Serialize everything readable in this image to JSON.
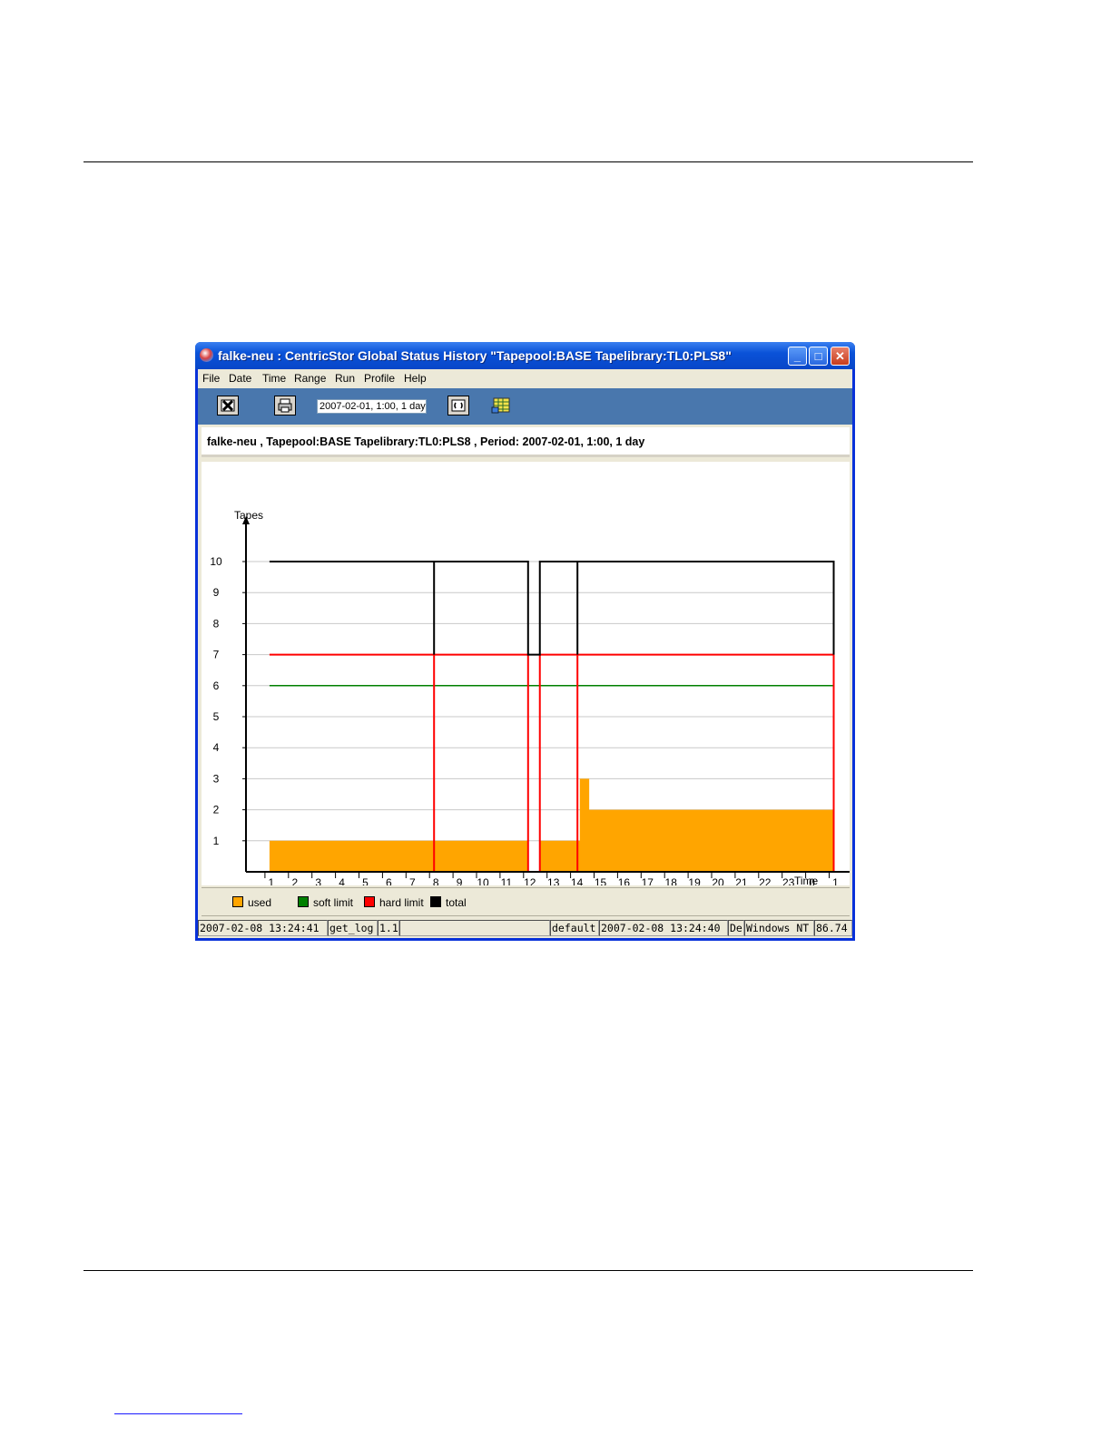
{
  "window": {
    "title": "falke-neu : CentricStor Global Status History \"Tapepool:BASE Tapelibrary:TL0:PLS8\"",
    "buttons": {
      "minimize": "_",
      "maximize": "□",
      "close": "✕"
    }
  },
  "menu": [
    "File",
    "Date",
    "Time",
    "Range",
    "Run",
    "Profile",
    "Help"
  ],
  "toolbar": {
    "exit_icon": "close-x-icon",
    "print_icon": "printer-icon",
    "period_value": "2007-02-01, 1:00, 1 day",
    "refresh_icon": "refresh-icon",
    "table_icon": "table-icon"
  },
  "info_text": "falke-neu , Tapepool:BASE Tapelibrary:TL0:PLS8 , Period: 2007-02-01, 1:00, 1 day",
  "chart_data": {
    "type": "area",
    "ylabel": "Tapes",
    "xlabel": "Time",
    "ylim": [
      0,
      10
    ],
    "yticks": [
      1,
      2,
      3,
      4,
      5,
      6,
      7,
      8,
      9,
      10
    ],
    "xticks": [
      "1",
      "2",
      "3",
      "4",
      "5",
      "6",
      "7",
      "8",
      "9",
      "10",
      "11",
      "12",
      "13",
      "14",
      "15",
      "16",
      "17",
      "18",
      "19",
      "20",
      "21",
      "22",
      "23",
      "0",
      "1"
    ],
    "x_unit": "hours since 2007-02-01 0:00",
    "grid": true,
    "series": [
      {
        "name": "used",
        "color": "#ffa500",
        "style": "area",
        "points": [
          [
            1,
            0
          ],
          [
            1,
            1
          ],
          [
            12,
            1
          ],
          [
            12,
            0
          ],
          [
            12.5,
            0
          ],
          [
            12.5,
            1
          ],
          [
            14.2,
            1
          ],
          [
            14.2,
            3
          ],
          [
            14.6,
            3
          ],
          [
            14.6,
            2
          ],
          [
            25,
            2
          ],
          [
            25,
            0
          ]
        ]
      },
      {
        "name": "soft limit",
        "color": "#008000",
        "style": "line",
        "points": [
          [
            1,
            6
          ],
          [
            25,
            6
          ]
        ]
      },
      {
        "name": "hard limit",
        "color": "#ff0000",
        "style": "line",
        "points": [
          [
            1,
            7
          ],
          [
            8,
            7
          ],
          [
            8,
            0
          ],
          [
            8,
            7
          ],
          [
            12,
            7
          ],
          [
            12,
            0
          ],
          [
            12.5,
            0
          ],
          [
            12.5,
            7
          ],
          [
            14.1,
            7
          ],
          [
            14.1,
            0
          ],
          [
            14.1,
            7
          ],
          [
            25,
            7
          ],
          [
            25,
            0
          ]
        ]
      },
      {
        "name": "total",
        "color": "#000000",
        "style": "line",
        "points": [
          [
            1,
            10
          ],
          [
            8,
            10
          ],
          [
            8,
            7
          ],
          [
            8,
            10
          ],
          [
            12,
            10
          ],
          [
            12,
            7
          ],
          [
            12.5,
            7
          ],
          [
            12.5,
            10
          ],
          [
            14.1,
            10
          ],
          [
            14.1,
            7
          ],
          [
            14.1,
            10
          ],
          [
            25,
            10
          ],
          [
            25,
            7
          ]
        ]
      }
    ],
    "legend": [
      "used",
      "soft limit",
      "hard limit",
      "total"
    ],
    "legend_position": "bottom"
  },
  "legend": [
    {
      "label": "used",
      "color": "#ffa500"
    },
    {
      "label": "soft limit",
      "color": "#008000"
    },
    {
      "label": "hard limit",
      "color": "#ff0000"
    },
    {
      "label": "total",
      "color": "#000000"
    }
  ],
  "statusbar": [
    "2007-02-08 13:24:41",
    "get_log",
    "1.1",
    "",
    "default",
    "2007-02-08 13:24:40",
    "De",
    "Windows NT",
    "86.74"
  ]
}
